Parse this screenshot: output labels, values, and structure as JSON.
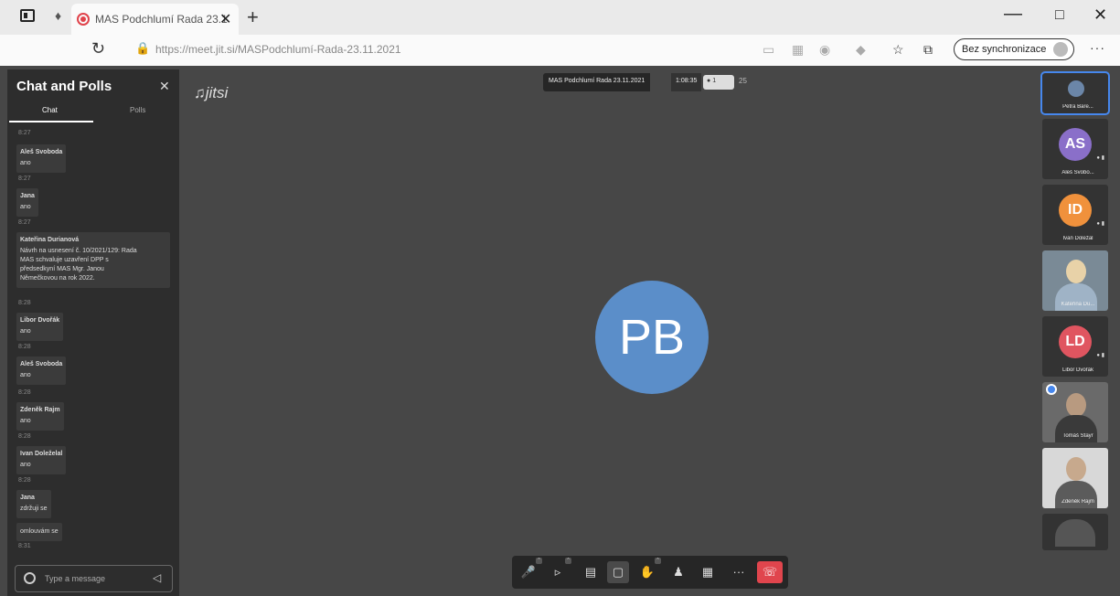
{
  "browser": {
    "tab_title": "MAS Podchlumí Rada 23.1",
    "url": "https://meet.jit.si/MASPodchlumí-Rada-23.11.2021",
    "sync_label": "Bez synchronizace"
  },
  "chat": {
    "title": "Chat and Polls",
    "tabs": [
      "Chat",
      "Polls"
    ],
    "input_placeholder": "Type a message",
    "messages": [
      {
        "time": "8:27",
        "name": "Aleš Svoboda",
        "text": [
          "ano"
        ]
      },
      {
        "time": "8:27",
        "name": "Jana",
        "text": [
          "ano"
        ]
      },
      {
        "time": "8:27",
        "name": "Kateřina Durianová",
        "text": [
          "Návrh na usnesení č. 10/2021/129: Rada",
          "MAS schvaluje uzavření DPP s",
          "předsedkyní MAS Mgr. Janou",
          "Němečkovou na rok 2022."
        ]
      },
      {
        "time": "8:28",
        "name": "Libor Dvořák",
        "text": [
          "ano"
        ]
      },
      {
        "time": "8:28",
        "name": "Aleš Svoboda",
        "text": [
          "ano"
        ]
      },
      {
        "time": "8:28",
        "name": "Zdeněk Rajm",
        "text": [
          "ano"
        ]
      },
      {
        "time": "8:28",
        "name": "Ivan Doleželal",
        "text": [
          "ano"
        ]
      },
      {
        "time": "8:28",
        "name": "Jana",
        "text": [
          "zdržuji se"
        ]
      },
      {
        "time": "",
        "name": "",
        "text": [
          "omlouvám se"
        ]
      }
    ],
    "last_time": "8:31"
  },
  "meeting": {
    "logo": "jitsi",
    "title": "MAS Podchlumí Rada 23.11.2021",
    "duration": "1:08:35",
    "participants": "1",
    "extra": "25",
    "main_initials": "PB"
  },
  "colors": {
    "stage_bg": "#474747",
    "main_avatar": "#5b8ec9",
    "hangup": "#e0454d",
    "active_border": "#4687ed"
  },
  "toolbar": {
    "buttons": [
      "mic-muted-icon",
      "camera-off-icon",
      "share-screen-icon",
      "chat-icon",
      "raise-hand-icon",
      "invite-icon",
      "tile-view-icon",
      "more-icon",
      "hangup-icon"
    ]
  },
  "filmstrip": [
    {
      "name": "Petra Bare...",
      "type": "avatar-small"
    },
    {
      "name": "Aleš Svobo...",
      "initials": "AS",
      "color": "#8a6fc9"
    },
    {
      "name": "Ivan Doležal",
      "initials": "ID",
      "color": "#f0913c"
    },
    {
      "name": "Kateřina Du...",
      "type": "video"
    },
    {
      "name": "Libor Dvořák",
      "initials": "LD",
      "color": "#e05560"
    },
    {
      "name": "Tomáš Štayr",
      "type": "video"
    },
    {
      "name": "Zdeněk Rajm",
      "type": "video"
    }
  ]
}
